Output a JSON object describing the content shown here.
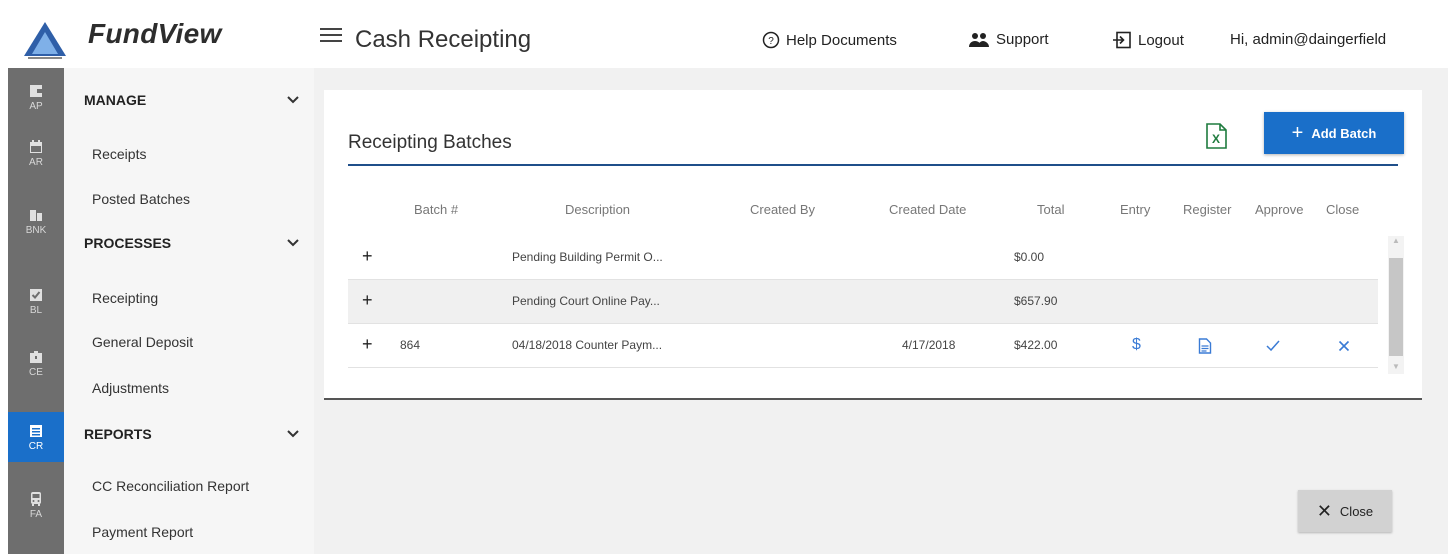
{
  "header": {
    "brand": "FundView",
    "page_title": "Cash Receipting",
    "links": {
      "help": "Help Documents",
      "support": "Support",
      "logout": "Logout"
    },
    "user_greeting": "Hi, admin@daingerfield"
  },
  "rail": {
    "items": [
      {
        "label": "AP",
        "icon": "wallet-icon"
      },
      {
        "label": "AR",
        "icon": "calendar-icon"
      },
      {
        "label": "BNK",
        "icon": "bank-icon"
      },
      {
        "label": "BL",
        "icon": "clipboard-check-icon"
      },
      {
        "label": "CE",
        "icon": "briefcase-icon"
      },
      {
        "label": "CR",
        "icon": "list-icon",
        "active": true
      },
      {
        "label": "FA",
        "icon": "bus-icon"
      }
    ]
  },
  "sidebar": {
    "sections": [
      {
        "label": "MANAGE",
        "items": [
          "Receipts",
          "Posted Batches"
        ]
      },
      {
        "label": "PROCESSES",
        "items": [
          "Receipting",
          "General Deposit",
          "Adjustments"
        ]
      },
      {
        "label": "REPORTS",
        "items": [
          "CC Reconciliation Report",
          "Payment Report"
        ]
      }
    ]
  },
  "card": {
    "title": "Receipting Batches",
    "add_batch_label": "Add Batch",
    "columns": [
      "Batch #",
      "Description",
      "Created By",
      "Created Date",
      "Total",
      "Entry",
      "Register",
      "Approve",
      "Close"
    ],
    "rows": [
      {
        "batch": "",
        "description": "Pending Building Permit O...",
        "created_by": "",
        "created_date": "",
        "total": "$0.00",
        "actions": false
      },
      {
        "batch": "",
        "description": "Pending Court Online Pay...",
        "created_by": "",
        "created_date": "",
        "total": "$657.90",
        "actions": false
      },
      {
        "batch": "864",
        "description": "04/18/2018 Counter Paym...",
        "created_by": "",
        "created_date": "4/17/2018",
        "total": "$422.00",
        "actions": true
      }
    ]
  },
  "footer": {
    "close_label": "Close"
  },
  "colors": {
    "accent": "#1a6fc9",
    "rail": "#6e6e6e",
    "title_rule": "#1f4f8a"
  }
}
